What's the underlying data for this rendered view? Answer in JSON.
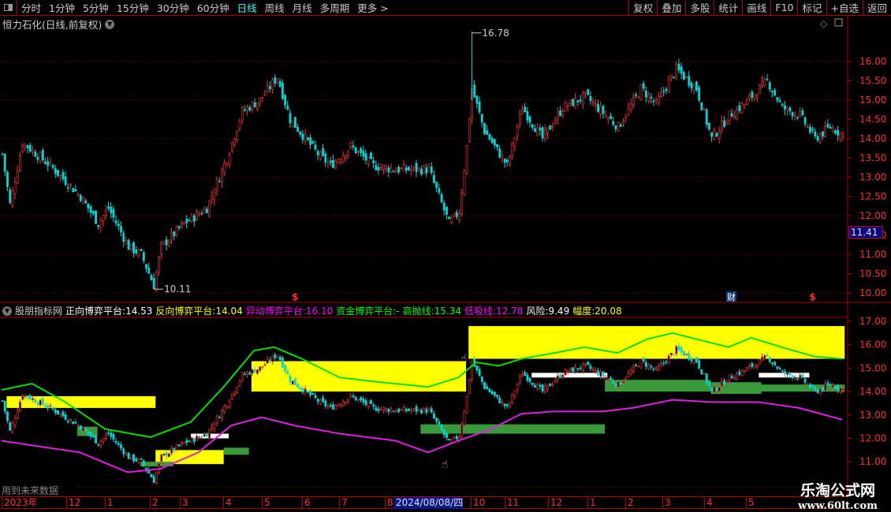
{
  "toolbar": {
    "periods": [
      "分时",
      "1分钟",
      "5分钟",
      "15分钟",
      "30分钟",
      "60分钟",
      "日线",
      "周线",
      "月线",
      "多周期",
      "更多 >"
    ],
    "active_period": "日线",
    "buttons": [
      "复权",
      "叠加",
      "多股",
      "统计",
      "画线",
      "F10",
      "标记",
      "+自选",
      "返回"
    ]
  },
  "title": "恒力石化(日线,前复权)",
  "price_labels": {
    "high": "16.78",
    "low": "10.11",
    "current": "11.41"
  },
  "markers": {
    "s": "$",
    "cai": "财"
  },
  "indicator": {
    "name": "股朋指标网",
    "items": [
      {
        "label": "正向博弈平台:",
        "value": "14.53",
        "color": "#ffffff"
      },
      {
        "label": "反向博弈平台:",
        "value": "14.04",
        "color": "#ffff00"
      },
      {
        "label": "异动博弈平台:",
        "value": "16.10",
        "color": "#ff00ff"
      },
      {
        "label": "资金博弈平台:",
        "value": "-",
        "color": "#00ff00"
      },
      {
        "label": "高抛线:",
        "value": "15.34",
        "color": "#00ff00"
      },
      {
        "label": "低吸线:",
        "value": "12.78",
        "color": "#ff00ff"
      },
      {
        "label": "风险:",
        "value": "9.49",
        "color": "#ffffff"
      },
      {
        "label": "幅度:",
        "value": "20.08",
        "color": "#ffff00"
      }
    ]
  },
  "future_note": "用到未来数据",
  "time_axis": [
    "2023年",
    "12",
    "1",
    "2",
    "3",
    "4",
    "5",
    "6",
    "7",
    "8",
    "2024/08/08/四",
    "10",
    "11",
    "12",
    "1",
    "2",
    "3",
    "4",
    "5"
  ],
  "watermark": {
    "name": "乐淘公式网",
    "url": "www.60lt.com"
  },
  "chart_data": {
    "type": "candlestick",
    "total_bars": 334,
    "upper_axis": {
      "ticks": [
        "16.00",
        "15.50",
        "15.00",
        "14.50",
        "14.00",
        "13.50",
        "13.00",
        "12.50",
        "12.00",
        "11.50",
        "11.00",
        "10.50",
        "10.00"
      ],
      "range": [
        10.0,
        16.0
      ]
    },
    "lower_axis": {
      "ticks": [
        "17.00",
        "16.00",
        "15.00",
        "14.00",
        "13.00",
        "12.00",
        "11.00"
      ],
      "range": [
        11.0,
        17.0
      ]
    },
    "close_path": [
      [
        0,
        13.6
      ],
      [
        3,
        12.3
      ],
      [
        8,
        13.9
      ],
      [
        19,
        13.3
      ],
      [
        31,
        12.5
      ],
      [
        38,
        11.8
      ],
      [
        42,
        12.2
      ],
      [
        50,
        11.2
      ],
      [
        55,
        11.0
      ],
      [
        60,
        10.2
      ],
      [
        63,
        11.2
      ],
      [
        72,
        11.8
      ],
      [
        81,
        12.2
      ],
      [
        89,
        13.5
      ],
      [
        95,
        14.7
      ],
      [
        102,
        15.0
      ],
      [
        109,
        15.6
      ],
      [
        114,
        14.5
      ],
      [
        125,
        13.6
      ],
      [
        130,
        13.3
      ],
      [
        138,
        13.8
      ],
      [
        147,
        13.3
      ],
      [
        156,
        13.2
      ],
      [
        169,
        13.2
      ],
      [
        177,
        11.8
      ],
      [
        181,
        12.1
      ],
      [
        184,
        13.8
      ],
      [
        186,
        15.3
      ],
      [
        191,
        14.2
      ],
      [
        200,
        13.3
      ],
      [
        206,
        14.8
      ],
      [
        214,
        14.0
      ],
      [
        222,
        14.8
      ],
      [
        231,
        15.1
      ],
      [
        244,
        14.3
      ],
      [
        253,
        15.3
      ],
      [
        259,
        14.9
      ],
      [
        267,
        15.8
      ],
      [
        275,
        15.3
      ],
      [
        281,
        14.0
      ],
      [
        288,
        14.6
      ],
      [
        294,
        14.9
      ],
      [
        303,
        15.5
      ],
      [
        309,
        14.8
      ],
      [
        316,
        14.6
      ],
      [
        322,
        14.0
      ],
      [
        328,
        14.3
      ],
      [
        333,
        14.1
      ]
    ],
    "high_line": [
      [
        0,
        14.07
      ],
      [
        12,
        14.34
      ],
      [
        25,
        13.57
      ],
      [
        41,
        12.4
      ],
      [
        59,
        12.05
      ],
      [
        75,
        12.7
      ],
      [
        88,
        14.2
      ],
      [
        100,
        15.75
      ],
      [
        108,
        15.9
      ],
      [
        119,
        15.4
      ],
      [
        134,
        14.6
      ],
      [
        150,
        14.4
      ],
      [
        169,
        14.2
      ],
      [
        181,
        14.6
      ],
      [
        188,
        15.25
      ],
      [
        197,
        15.1
      ],
      [
        206,
        15.4
      ],
      [
        219,
        15.65
      ],
      [
        231,
        15.9
      ],
      [
        244,
        15.65
      ],
      [
        256,
        16.25
      ],
      [
        266,
        16.5
      ],
      [
        275,
        16.25
      ],
      [
        288,
        15.9
      ],
      [
        297,
        16.3
      ],
      [
        309,
        15.9
      ],
      [
        322,
        15.5
      ],
      [
        333,
        15.4
      ]
    ],
    "low_line": [
      [
        0,
        11.9
      ],
      [
        12,
        11.7
      ],
      [
        31,
        11.4
      ],
      [
        50,
        10.55
      ],
      [
        63,
        10.7
      ],
      [
        78,
        11.4
      ],
      [
        91,
        12.55
      ],
      [
        103,
        12.9
      ],
      [
        116,
        12.55
      ],
      [
        134,
        12.2
      ],
      [
        156,
        11.9
      ],
      [
        169,
        11.4
      ],
      [
        181,
        11.9
      ],
      [
        194,
        12.4
      ],
      [
        206,
        13.05
      ],
      [
        219,
        13.15
      ],
      [
        238,
        13.15
      ],
      [
        250,
        13.3
      ],
      [
        266,
        13.65
      ],
      [
        281,
        13.55
      ],
      [
        300,
        13.55
      ],
      [
        316,
        13.3
      ],
      [
        333,
        12.8
      ]
    ],
    "yellow_zones": [
      [
        2,
        61,
        13.3,
        13.8
      ],
      [
        99,
        184,
        14.0,
        15.3
      ],
      [
        185,
        334,
        15.4,
        16.8
      ],
      [
        61,
        88,
        10.9,
        11.5
      ]
    ],
    "green_zones": [
      [
        166,
        239,
        12.2,
        12.6
      ],
      [
        239,
        281,
        14.0,
        14.5
      ],
      [
        281,
        301,
        13.9,
        14.4
      ],
      [
        301,
        334,
        14.0,
        14.3
      ],
      [
        30,
        38,
        12.1,
        12.5
      ],
      [
        55,
        68,
        10.8,
        11.0
      ],
      [
        88,
        98,
        11.3,
        11.6
      ]
    ],
    "white_zones": [
      [
        75,
        90,
        12.0,
        12.2
      ],
      [
        210,
        240,
        14.6,
        14.8
      ],
      [
        300,
        320,
        14.6,
        14.8
      ]
    ]
  }
}
